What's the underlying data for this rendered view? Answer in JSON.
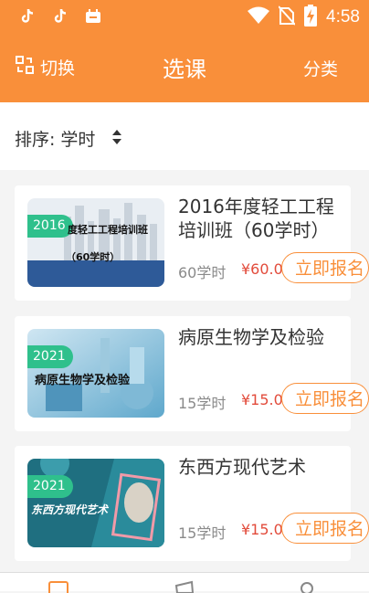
{
  "status_bar": {
    "time": "4:58",
    "icons": [
      "tiktok-icon",
      "tiktok-icon",
      "android-app-icon",
      "wifi-icon",
      "no-sim-icon",
      "battery-charging-icon"
    ]
  },
  "header": {
    "switch_label": "切换",
    "title": "选课",
    "category_label": "分类"
  },
  "sort": {
    "label": "排序:",
    "value": "学时"
  },
  "courses": [
    {
      "year": "2016",
      "thumb_line1": "度轻工工程培训班",
      "thumb_line2": "（60学时）",
      "title": "2016年度轻工工程培训班（60学时）",
      "hours": "60学时",
      "price": "¥60.0",
      "enroll_label": "立即报名"
    },
    {
      "year": "2021",
      "thumb_line1": "病原生物学及检验",
      "title": "病原生物学及检验",
      "hours": "15学时",
      "price": "¥15.0",
      "enroll_label": "立即报名"
    },
    {
      "year": "2021",
      "thumb_line1": "东西方现代艺术",
      "title": "东西方现代艺术",
      "hours": "15学时",
      "price": "¥15.0",
      "enroll_label": "立即报名"
    }
  ],
  "colors": {
    "accent": "#f98f3a",
    "badge": "#2fc08c",
    "price": "#e24b3b"
  }
}
